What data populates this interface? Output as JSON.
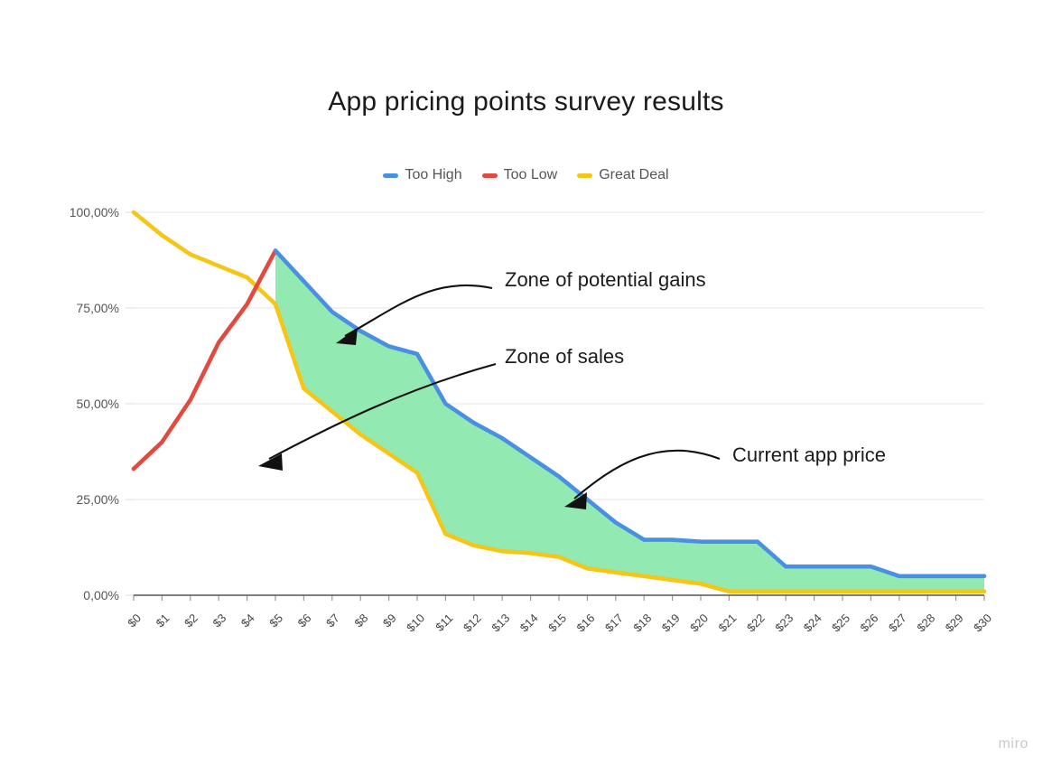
{
  "header": {
    "title": "App pricing points survey results"
  },
  "watermark": {
    "label": "miro"
  },
  "legend": {
    "position": "top-center",
    "items": [
      {
        "label": "Too High",
        "color": "#4a90e2"
      },
      {
        "label": "Too Low",
        "color": "#e2493f"
      },
      {
        "label": "Great Deal",
        "color": "#f5c518"
      }
    ]
  },
  "annotations": [
    {
      "id": "zone-of-potential-gains",
      "label": "Zone of potential gains"
    },
    {
      "id": "zone-of-sales",
      "label": "Zone of sales"
    },
    {
      "id": "current-app-price",
      "label": "Current app price"
    }
  ],
  "axes": {
    "y": {
      "ticks": [
        "100,00%",
        "75,00%",
        "50,00%",
        "25,00%",
        "0,00%"
      ],
      "min": 0,
      "max": 100
    },
    "x": {
      "ticks": [
        "$0",
        "$1",
        "$2",
        "$3",
        "$4",
        "$5",
        "$6",
        "$7",
        "$8",
        "$9",
        "$10",
        "$11",
        "$12",
        "$13",
        "$14",
        "$15",
        "$16",
        "$17",
        "$18",
        "$19",
        "$20",
        "$21",
        "$22",
        "$23",
        "$24",
        "$25",
        "$26",
        "$27",
        "$28",
        "$29",
        "$30"
      ]
    }
  },
  "colors": {
    "too_high": "#4a90e2",
    "too_low": "#e2493f",
    "great_deal": "#f5c518",
    "fill_zone": "#8ce8ad",
    "gridline": "#e6e6e6",
    "axis": "#555555",
    "text": "#1a1a1a"
  },
  "chart_data": {
    "type": "line",
    "title": "App pricing points survey results",
    "xlabel": "",
    "ylabel": "",
    "ylim": [
      0,
      100
    ],
    "grid": true,
    "legend_position": "top-center",
    "x": [
      "$0",
      "$1",
      "$2",
      "$3",
      "$4",
      "$5",
      "$6",
      "$7",
      "$8",
      "$9",
      "$10",
      "$11",
      "$12",
      "$13",
      "$14",
      "$15",
      "$16",
      "$17",
      "$18",
      "$19",
      "$20",
      "$21",
      "$22",
      "$23",
      "$24",
      "$25",
      "$26",
      "$27",
      "$28",
      "$29",
      "$30"
    ],
    "series": [
      {
        "name": "Too High",
        "color": "#4a90e2",
        "x": [
          "$5",
          "$6",
          "$7",
          "$8",
          "$9",
          "$10",
          "$11",
          "$12",
          "$13",
          "$14",
          "$15",
          "$16",
          "$17",
          "$18",
          "$19",
          "$20",
          "$21",
          "$22",
          "$23",
          "$24",
          "$25",
          "$26",
          "$27",
          "$28",
          "$29",
          "$30"
        ],
        "values": [
          90,
          82,
          74,
          69,
          65,
          63,
          50,
          45,
          41,
          36,
          31,
          25,
          19,
          14.5,
          14.5,
          14,
          14,
          14,
          7.5,
          7.5,
          7.5,
          7.5,
          5,
          5,
          5,
          5,
          5
        ]
      },
      {
        "name": "Too Low",
        "color": "#e2493f",
        "x": [
          "$0",
          "$1",
          "$2",
          "$3",
          "$4",
          "$5"
        ],
        "values": [
          33,
          40,
          51,
          66,
          76,
          90
        ]
      },
      {
        "name": "Great Deal",
        "color": "#f5c518",
        "x": [
          "$0",
          "$1",
          "$2",
          "$3",
          "$4",
          "$5",
          "$6",
          "$7",
          "$8",
          "$9",
          "$10",
          "$11",
          "$12",
          "$13",
          "$14",
          "$15",
          "$16",
          "$17",
          "$18",
          "$19",
          "$20",
          "$21",
          "$22",
          "$23",
          "$24",
          "$25",
          "$26",
          "$27",
          "$28",
          "$29",
          "$30"
        ],
        "values": [
          100,
          94,
          89,
          86,
          83,
          76,
          54,
          48,
          42,
          37,
          32,
          16,
          13,
          11.5,
          11,
          10,
          7,
          6,
          5,
          4,
          3,
          1,
          1,
          1,
          1,
          1,
          1,
          1,
          1,
          1,
          1
        ]
      }
    ],
    "shaded_zone": {
      "label": "Zone of sales",
      "between": [
        "Too High",
        "Great Deal"
      ],
      "from_x": "$5",
      "to_x": "$30",
      "color": "#8ce8ad"
    }
  }
}
